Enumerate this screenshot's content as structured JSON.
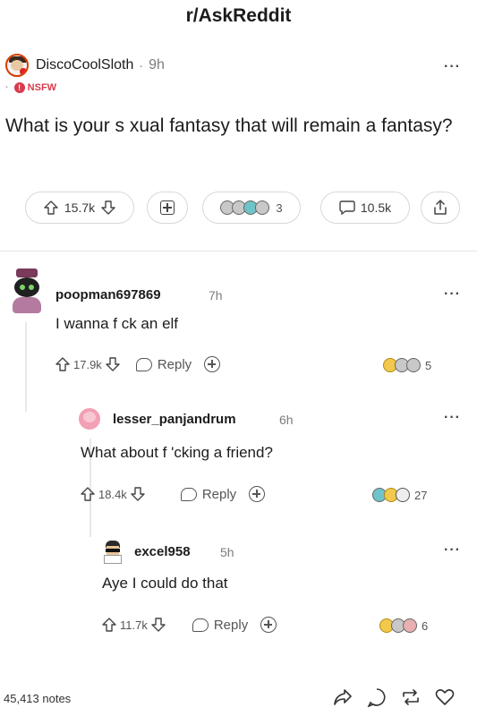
{
  "subreddit": "r/AskReddit",
  "post": {
    "author": "DiscoCoolSloth",
    "separator": "·",
    "time": "9h",
    "flair_bullet": "·",
    "nsfw_label": "NSFW",
    "nsfw_icon_glyph": "!",
    "title": "What is your s  xual fantasy that will remain a fantasy?",
    "upvotes": "15.7k",
    "award_count": "3",
    "comments": "10.5k",
    "more": "···"
  },
  "comments": [
    {
      "author": "poopman697869",
      "time": "7h",
      "text": "I wanna f   ck an elf",
      "upvotes": "17.9k",
      "reply_label": "Reply",
      "award_count": "5",
      "more": "···"
    },
    {
      "author": "lesser_panjandrum",
      "time": "6h",
      "text": "What about f  'cking a friend?",
      "upvotes": "18.4k",
      "reply_label": "Reply",
      "award_count": "27",
      "more": "···"
    },
    {
      "author": "excel958",
      "time": "5h",
      "text": "Aye I could do that",
      "upvotes": "11.7k",
      "reply_label": "Reply",
      "award_count": "6",
      "more": "···"
    }
  ],
  "footer": {
    "notes": "45,413 notes"
  },
  "colors": {
    "nsfw": "#d93a4b",
    "text": "#1c1c1c",
    "muted": "#7c7c7c"
  }
}
